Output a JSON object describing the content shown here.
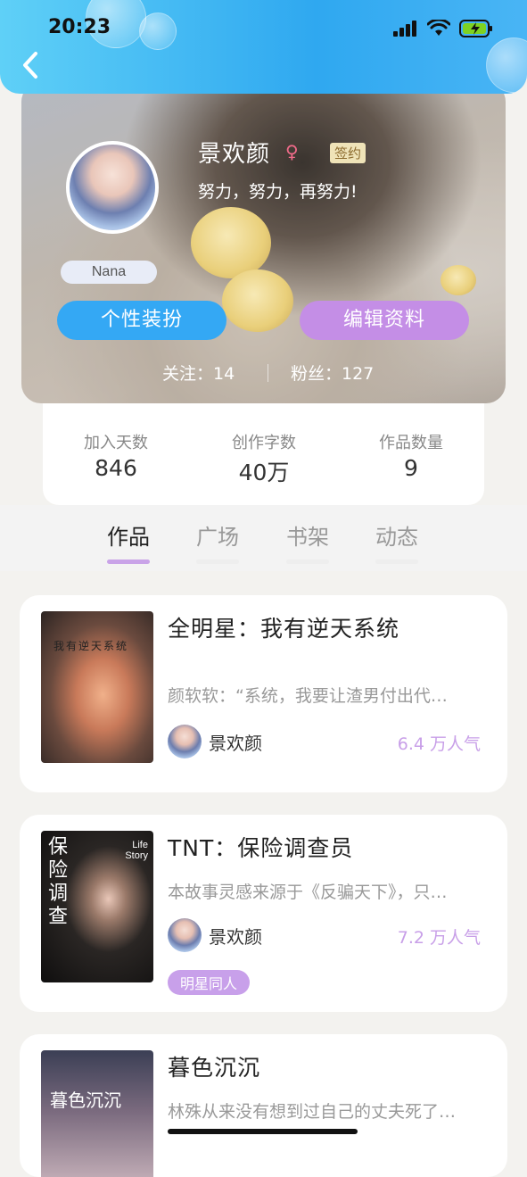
{
  "status_bar": {
    "time": "20:23"
  },
  "profile": {
    "username": "景欢颜",
    "gender_icon": "female-symbol",
    "sign_badge": "签约",
    "motto": "努力，努力，再努力!",
    "nickname_tag": "Nana",
    "dress_button": "个性装扮",
    "edit_button": "编辑资料",
    "following": "关注：14",
    "fans": "粉丝：127"
  },
  "stats": [
    {
      "label": "加入天数",
      "value": "846"
    },
    {
      "label": "创作字数",
      "value": "40万"
    },
    {
      "label": "作品数量",
      "value": "9"
    }
  ],
  "tabs": [
    {
      "label": "作品",
      "active": true
    },
    {
      "label": "广场",
      "active": false
    },
    {
      "label": "书架",
      "active": false
    },
    {
      "label": "动态",
      "active": false
    }
  ],
  "works": [
    {
      "title": "全明星：我有逆天系统",
      "desc": "颜软软：“系统，我要让渣男付出代…",
      "author": "景欢颜",
      "popularity": "6.4 万人气",
      "cover_text": "我有逆天系统"
    },
    {
      "title": "TNT：保险调查员",
      "desc": "本故事灵感来源于《反骗天下》，只…",
      "author": "景欢颜",
      "popularity": "7.2 万人气",
      "tag": "明星同人",
      "cover_text": "保险调查",
      "cover_sub": "Life Story"
    },
    {
      "title": "暮色沉沉",
      "desc": "林殊从来没有想到过自己的丈夫死了…",
      "cover_text": "暮色沉沉"
    }
  ],
  "colors": {
    "accent_blue": "#34a8f4",
    "accent_purple": "#c48ee6",
    "tag_purple": "#c8a0ea"
  }
}
